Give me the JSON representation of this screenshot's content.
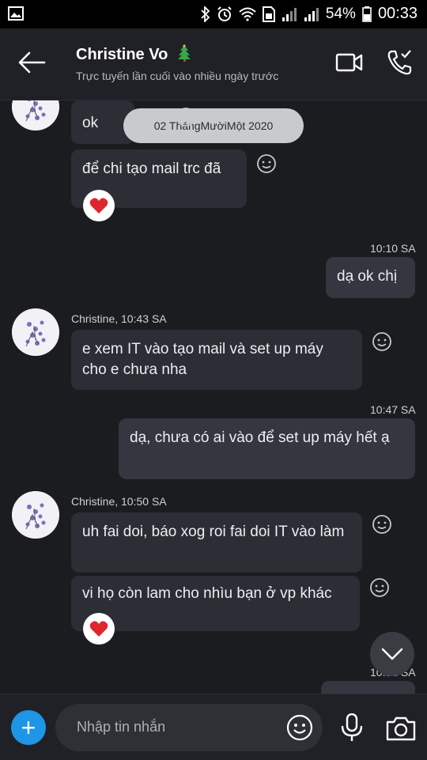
{
  "status_bar": {
    "battery": "54%",
    "time": "00:33"
  },
  "header": {
    "contact_name": "Christine Vo",
    "last_seen": "Trực tuyến lần cuối vào nhiều ngày trước"
  },
  "chat": {
    "date_separator": "02 ThángMườiMột 2020",
    "messages": [
      {
        "text": "ok"
      },
      {
        "text": "để chi tạo mail trc đã"
      },
      {
        "time": "10:10 SA",
        "text": "dạ ok chị"
      },
      {
        "sender": "Christine, 10:43 SA",
        "text": "e xem IT vào tạo mail và set up máy cho e chưa nha"
      },
      {
        "time": "10:47 SA",
        "text": "dạ, chưa có ai vào để set up máy hết ạ"
      },
      {
        "sender": "Christine, 10:50 SA",
        "text": "uh fai doi, báo xog roi fai doi IT vào làm"
      },
      {
        "text": "vi họ còn lam cho nhìu bạn ở vp khác"
      },
      {
        "time": "10:51 SA"
      }
    ]
  },
  "composer": {
    "placeholder": "Nhập tin nhắn"
  },
  "colors": {
    "accent": "#1f95e6",
    "heart": "#e0262d",
    "background": "#1b1c20"
  }
}
